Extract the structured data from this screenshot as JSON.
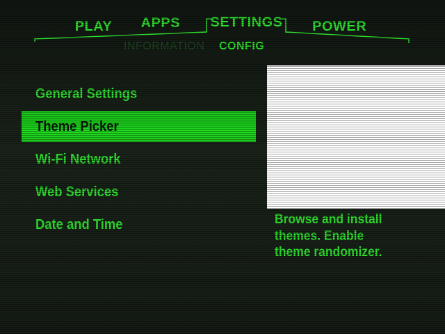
{
  "nav": {
    "tabs": [
      {
        "label": "PLAY"
      },
      {
        "label": "APPS"
      },
      {
        "label": "SETTINGS",
        "active": true
      },
      {
        "label": "POWER"
      }
    ],
    "subtabs": [
      {
        "label": "INFORMATION",
        "active": false
      },
      {
        "label": "CONFIG",
        "active": true
      }
    ]
  },
  "menu": {
    "items": [
      {
        "label": "General Settings"
      },
      {
        "label": "Theme Picker",
        "selected": true
      },
      {
        "label": "Wi-Fi Network"
      },
      {
        "label": "Web Services"
      },
      {
        "label": "Date and Time"
      }
    ]
  },
  "description": "Browse and install\nthemes.  Enable\ntheme randomizer.",
  "colors": {
    "accent": "#2fe02f",
    "dim": "#1f4a22",
    "background": "#151c15",
    "selected_text": "#0c160c"
  }
}
